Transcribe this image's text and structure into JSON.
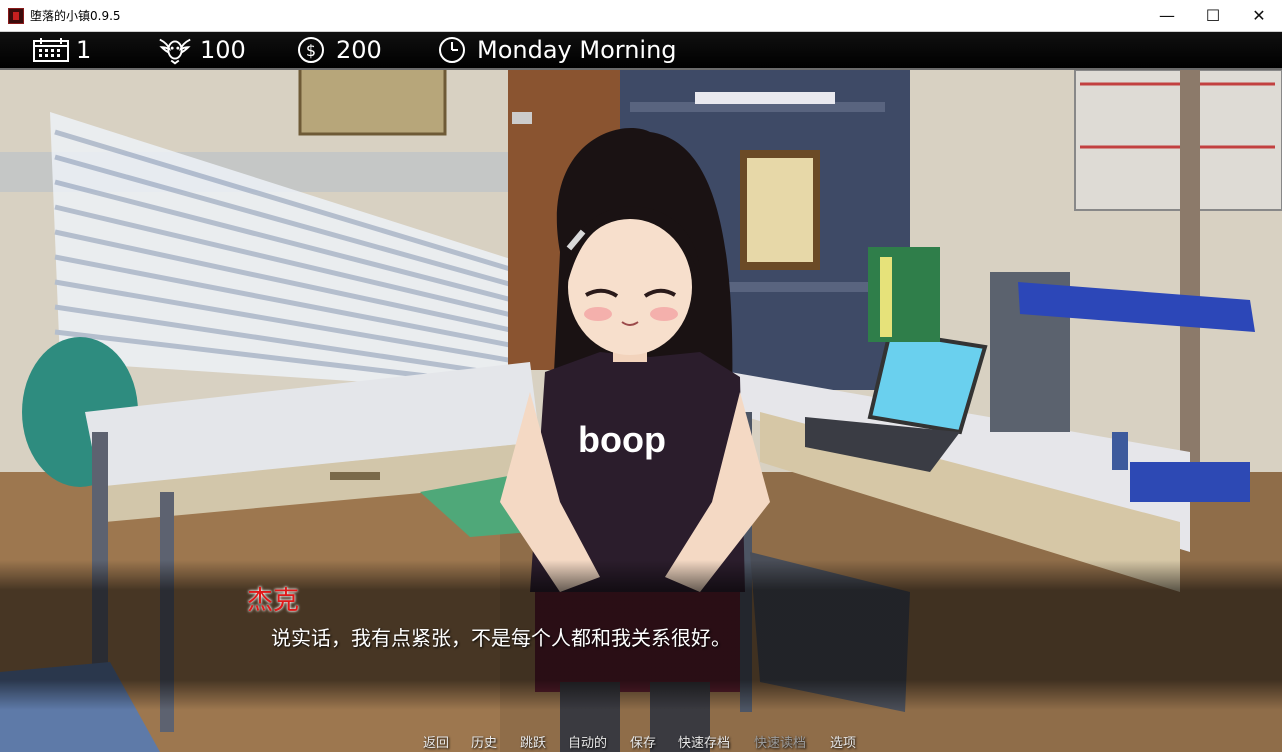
{
  "window": {
    "title": "堕落的小镇0.9.5",
    "controls": {
      "minimize": "—",
      "maximize": "☐",
      "close": "✕"
    }
  },
  "hud": {
    "day": "1",
    "corruption": "100",
    "money": "200",
    "time": "Monday Morning"
  },
  "dialogue": {
    "speaker": "杰克",
    "text": "说实话，我有点紧张，不是每个人都和我关系很好。",
    "speaker_color": "#e01818"
  },
  "quick_menu": {
    "back": "返回",
    "history": "历史",
    "skip": "跳跃",
    "auto": "自动的",
    "save": "保存",
    "quick_save": "快速存档",
    "quick_load": "快速读档",
    "preferences": "选项"
  },
  "scene": {
    "shirt_text": "boop"
  }
}
